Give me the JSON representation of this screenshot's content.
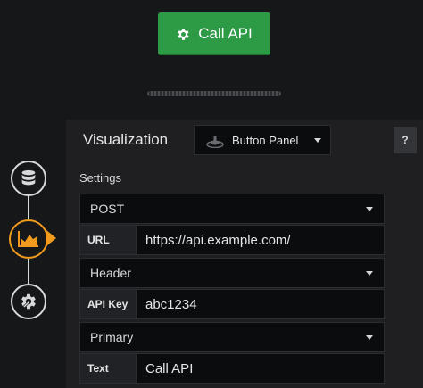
{
  "top_button": {
    "label": "Call API",
    "icon": "gear-icon",
    "color": "#2d9a45"
  },
  "editor": {
    "title": "Visualization",
    "viz_select": {
      "label": "Button Panel",
      "icon": "button-panel-icon"
    },
    "help_label": "?",
    "settings_label": "Settings",
    "method_select": "POST",
    "url": {
      "label": "URL",
      "value": "https://api.example.com/"
    },
    "auth_select": "Header",
    "api_key": {
      "label": "API Key",
      "value": "abc1234"
    },
    "style_select": "Primary",
    "text": {
      "label": "Text",
      "value": "Call API"
    }
  },
  "rail": {
    "items": [
      {
        "name": "queries",
        "icon": "database-icon"
      },
      {
        "name": "visualization",
        "icon": "chart-area-icon",
        "active": true,
        "color": "#f19a1e"
      },
      {
        "name": "general",
        "icon": "cog-wrench-icon"
      }
    ]
  }
}
